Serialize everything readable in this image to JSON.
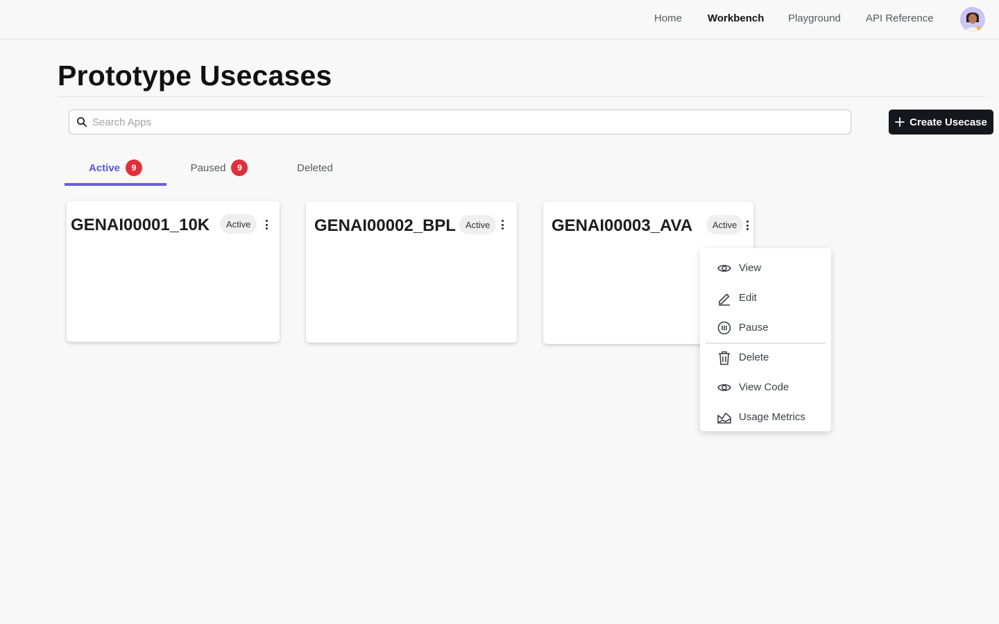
{
  "nav": {
    "links": [
      {
        "label": "Home",
        "active": false
      },
      {
        "label": "Workbench",
        "active": true
      },
      {
        "label": "Playground",
        "active": false
      },
      {
        "label": "API Reference",
        "active": false
      }
    ]
  },
  "page": {
    "title": "Prototype Usecases"
  },
  "search": {
    "placeholder": "Search Apps",
    "value": ""
  },
  "create_button": {
    "label": "Create Usecase"
  },
  "tabs": [
    {
      "label": "Active",
      "count": "9",
      "active": true
    },
    {
      "label": "Paused",
      "count": "9",
      "active": false
    },
    {
      "label": "Deleted",
      "count": "",
      "active": false
    }
  ],
  "cards": [
    {
      "title": "GENAI00001_10K",
      "status": "Active"
    },
    {
      "title": "GENAI00002_BPL",
      "status": "Active"
    },
    {
      "title": "GENAI00003_AVA",
      "status": "Active"
    }
  ],
  "menu": {
    "items": [
      {
        "label": "View",
        "icon": "eye-icon"
      },
      {
        "label": "Edit",
        "icon": "pencil-icon"
      },
      {
        "label": "Pause",
        "icon": "pause-icon"
      },
      {
        "label": "Delete",
        "icon": "trash-icon"
      },
      {
        "label": "View Code",
        "icon": "eye-icon"
      },
      {
        "label": "Usage Metrics",
        "icon": "chart-icon"
      }
    ]
  },
  "colors": {
    "accent": "#6560dd",
    "badge": "#e0313b",
    "primary_button": "#15171c"
  }
}
